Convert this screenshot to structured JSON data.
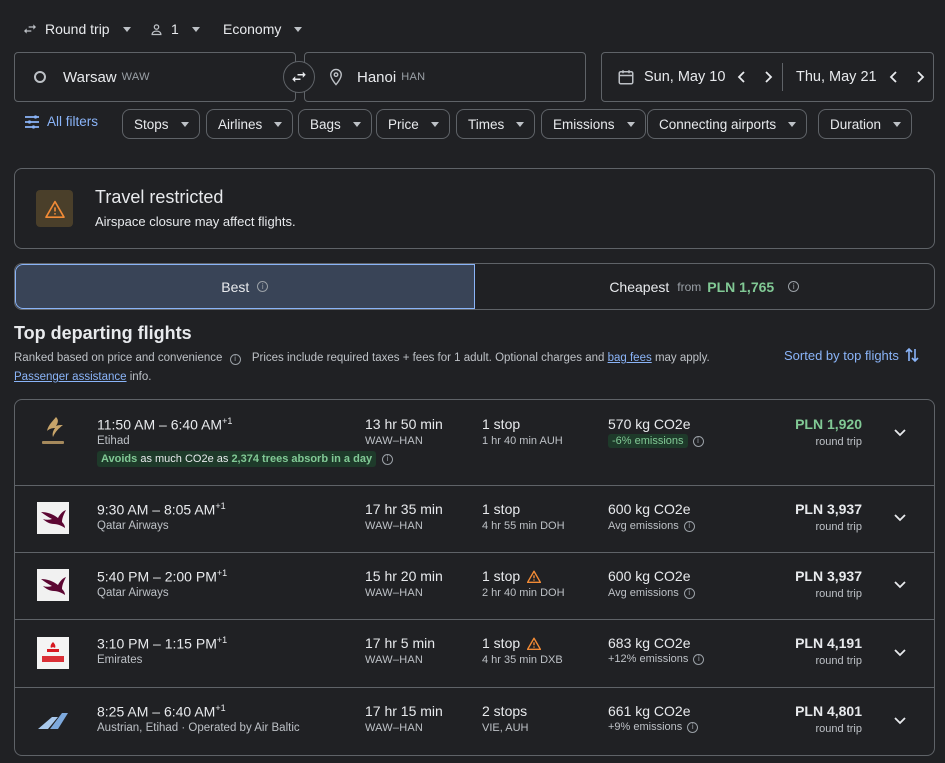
{
  "trip_options": {
    "trip_type": "Round trip",
    "passengers": "1",
    "cabin": "Economy"
  },
  "search": {
    "origin_city": "Warsaw",
    "origin_code": "WAW",
    "destination_city": "Hanoi",
    "destination_code": "HAN",
    "depart_date": "Sun, May 10",
    "return_date": "Thu, May 21"
  },
  "filters": {
    "all_filters": "All filters",
    "chips": [
      "Stops",
      "Airlines",
      "Bags",
      "Price",
      "Times",
      "Emissions",
      "Connecting airports",
      "Duration"
    ]
  },
  "banner": {
    "title": "Travel restricted",
    "subtitle": "Airspace closure may affect flights."
  },
  "tabs": {
    "best": "Best",
    "cheapest": "Cheapest",
    "from": "from",
    "cheapest_price": "PLN 1,765"
  },
  "section": {
    "title": "Top departing flights",
    "ranked": "Ranked based on price and convenience",
    "prices_note": "Prices include required taxes + fees for 1 adult. Optional charges and",
    "bag_fees": "bag fees",
    "may_apply": "may apply.",
    "passenger_assistance": "Passenger assistance",
    "info": "info.",
    "sorted_by": "Sorted by top flights"
  },
  "flights": [
    {
      "logo": "etihad-logo",
      "dep": "11:50 AM",
      "arr": "6:40 AM",
      "plus": "+1",
      "airline": "Etihad",
      "duration": "13 hr 50 min",
      "route": "WAW–HAN",
      "stops": "1 stop",
      "layover": "1 hr 40 min AUH",
      "warning": false,
      "co2": "570 kg CO2e",
      "emissions": "-6% emissions",
      "emissions_good": true,
      "price": "PLN 1,920",
      "price_green": true,
      "price_note": "round trip",
      "eco_lead": "Avoids",
      "eco_mid": "as much CO2e as",
      "eco_trees": "2,374 trees absorb in a day"
    },
    {
      "logo": "qatar-logo",
      "dep": "9:30 AM",
      "arr": "8:05 AM",
      "plus": "+1",
      "airline": "Qatar Airways",
      "duration": "17 hr 35 min",
      "route": "WAW–HAN",
      "stops": "1 stop",
      "layover": "4 hr 55 min DOH",
      "warning": false,
      "co2": "600 kg CO2e",
      "emissions": "Avg emissions",
      "emissions_good": false,
      "price": "PLN 3,937",
      "price_green": false,
      "price_note": "round trip"
    },
    {
      "logo": "qatar-logo",
      "dep": "5:40 PM",
      "arr": "2:00 PM",
      "plus": "+1",
      "airline": "Qatar Airways",
      "duration": "15 hr 20 min",
      "route": "WAW–HAN",
      "stops": "1 stop",
      "layover": "2 hr 40 min DOH",
      "warning": true,
      "co2": "600 kg CO2e",
      "emissions": "Avg emissions",
      "emissions_good": false,
      "price": "PLN 3,937",
      "price_green": false,
      "price_note": "round trip"
    },
    {
      "logo": "emirates-logo",
      "dep": "3:10 PM",
      "arr": "1:15 PM",
      "plus": "+1",
      "airline": "Emirates",
      "duration": "17 hr 5 min",
      "route": "WAW–HAN",
      "stops": "1 stop",
      "layover": "4 hr 35 min DXB",
      "warning": true,
      "co2": "683 kg CO2e",
      "emissions": "+12% emissions",
      "emissions_good": false,
      "price": "PLN 4,191",
      "price_green": false,
      "price_note": "round trip"
    },
    {
      "logo": "austrian-logo",
      "dep": "8:25 AM",
      "arr": "6:40 AM",
      "plus": "+1",
      "airline": "Austrian, Etihad · Operated by Air Baltic",
      "duration": "17 hr 15 min",
      "route": "WAW–HAN",
      "stops": "2 stops",
      "layover": "VIE, AUH",
      "warning": false,
      "co2": "661 kg CO2e",
      "emissions": "+9% emissions",
      "emissions_good": false,
      "price": "PLN 4,801",
      "price_green": false,
      "price_note": "round trip"
    }
  ],
  "colors": {
    "background": "#202124",
    "accent_blue": "#8ab4f8",
    "good_green": "#81c995",
    "warning_orange": "#f28b36"
  }
}
